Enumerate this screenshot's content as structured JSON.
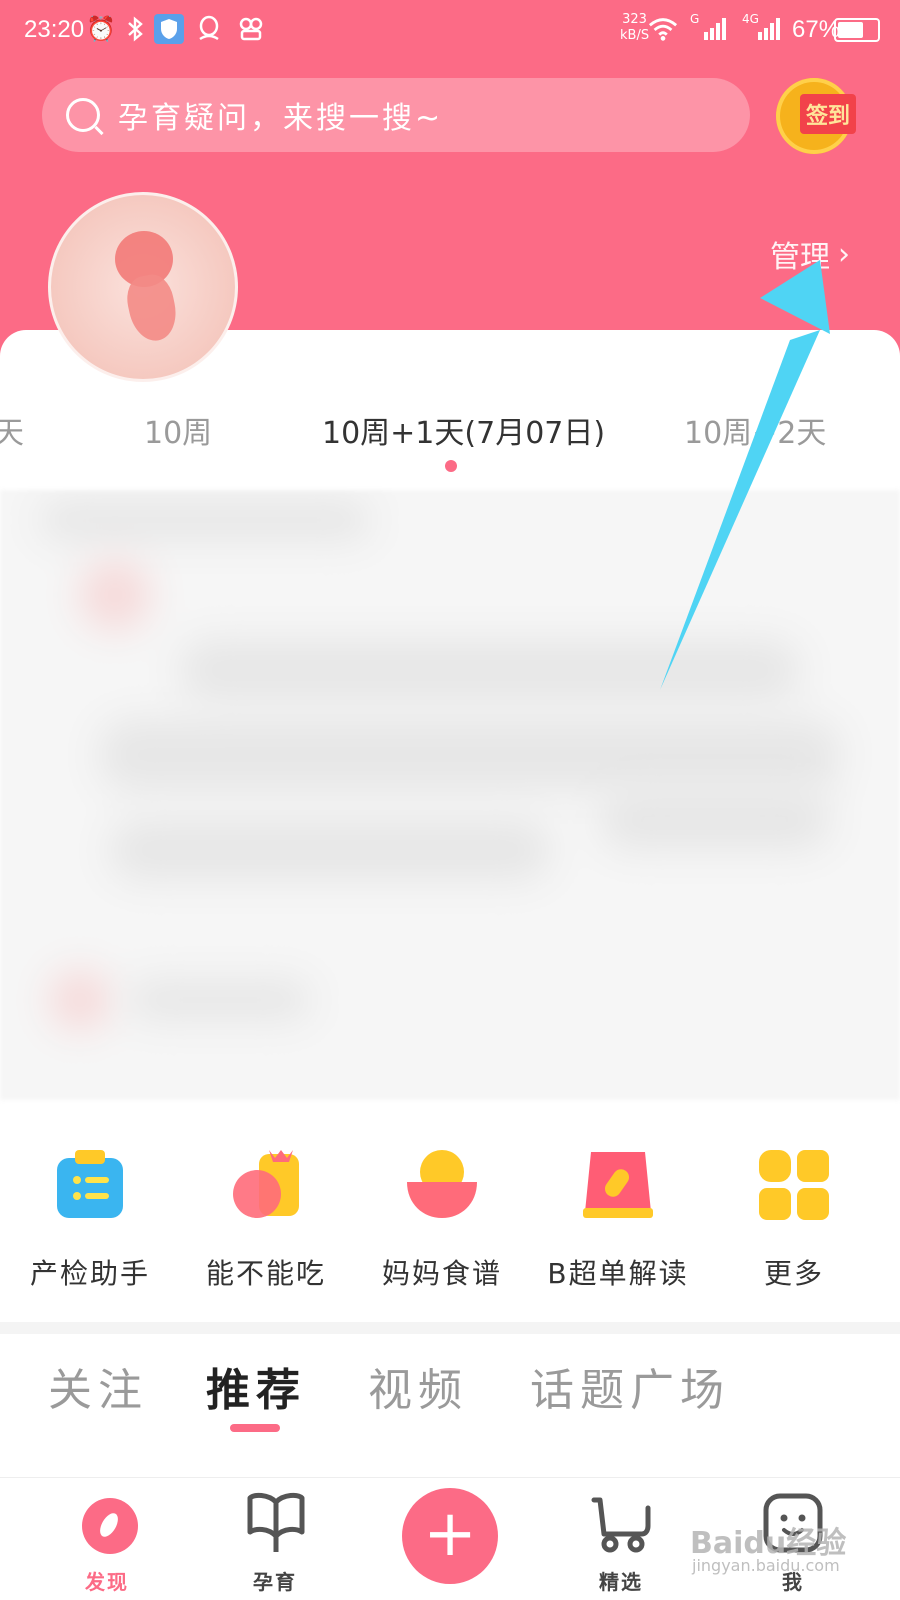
{
  "status_bar": {
    "time": "23:20",
    "speed_top": "323",
    "speed_bottom": "kB/S",
    "signal_g": "G",
    "signal_4g": "4G",
    "battery_text": "67%",
    "battery_level": 0.67
  },
  "search": {
    "placeholder": "孕育疑问，来搜一搜~"
  },
  "signin": {
    "label": "签到"
  },
  "manage": {
    "label": "管理",
    "chevron": "›"
  },
  "week_strip": {
    "prev_partial": "天",
    "prev": "10周",
    "current": "10周+1天(7月07日)",
    "next": "10周+2天"
  },
  "tools": [
    {
      "label": "产检助手",
      "icon": "clipboard-icon"
    },
    {
      "label": "能不能吃",
      "icon": "food-check-icon"
    },
    {
      "label": "妈妈食谱",
      "icon": "recipe-bowl-icon"
    },
    {
      "label": "B超单解读",
      "icon": "ultrasound-report-icon"
    },
    {
      "label": "更多",
      "icon": "grid-more-icon"
    }
  ],
  "feed_tabs": [
    {
      "label": "关注",
      "active": false
    },
    {
      "label": "推荐",
      "active": true
    },
    {
      "label": "视频",
      "active": false
    },
    {
      "label": "话题广场",
      "active": false
    }
  ],
  "bottom_nav": [
    {
      "label": "发现",
      "icon": "discover-icon",
      "active": true
    },
    {
      "label": "孕育",
      "icon": "book-icon",
      "active": false
    },
    {
      "label": "",
      "icon": "plus-icon",
      "active": false
    },
    {
      "label": "精选",
      "icon": "shopping-cart-icon",
      "active": false
    },
    {
      "label": "我",
      "icon": "profile-face-icon",
      "active": false
    }
  ],
  "watermark": {
    "brand": "Baidu经验",
    "url": "jingyan.baidu.com"
  },
  "colors": {
    "primary": "#fc6b86",
    "annotation_arrow": "#4fd4f4"
  }
}
